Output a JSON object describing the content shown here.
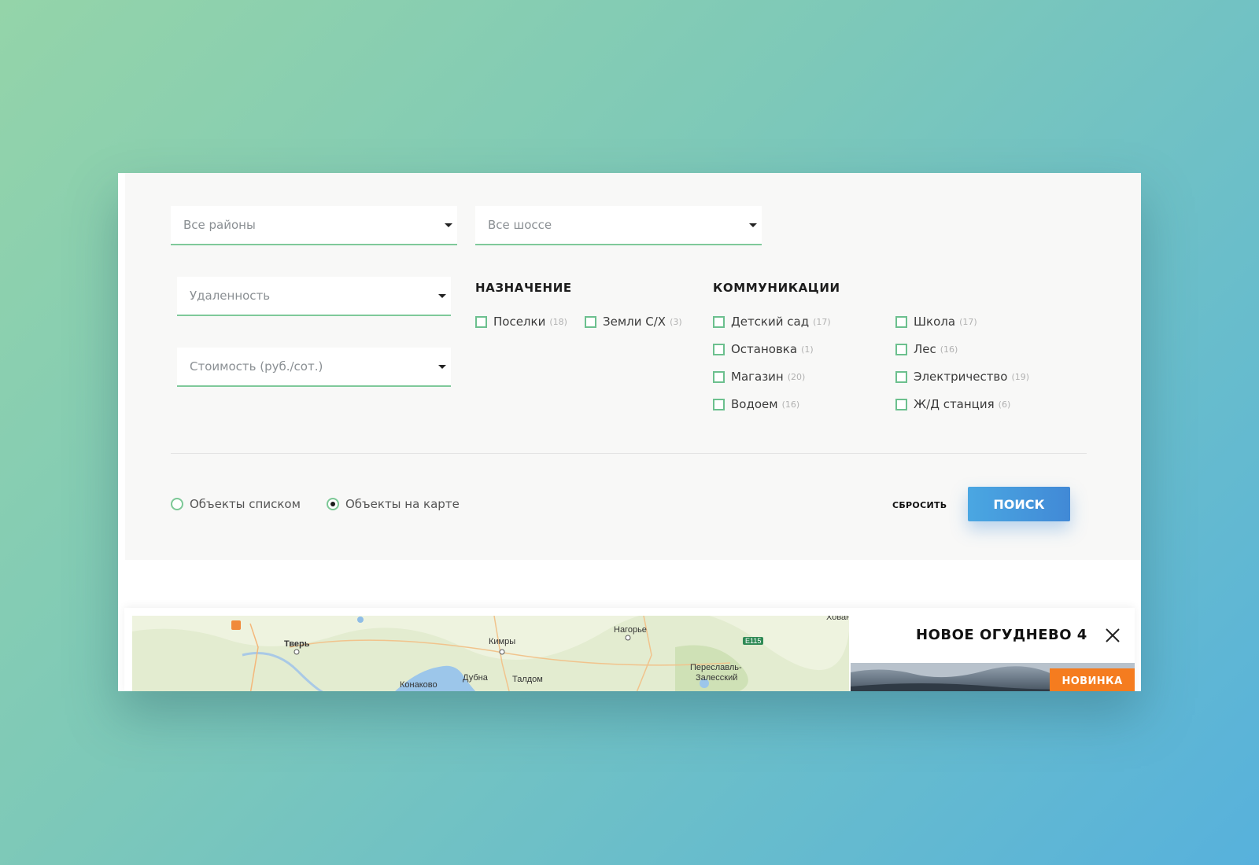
{
  "filters": {
    "district": {
      "placeholder": "Все районы"
    },
    "highway": {
      "placeholder": "Все шоссе"
    },
    "distance": {
      "placeholder": "Удаленность"
    },
    "price": {
      "placeholder": "Стоимость (руб./сот.)"
    }
  },
  "purpose": {
    "title": "НАЗНАЧЕНИЕ",
    "items": [
      {
        "label": "Поселки",
        "count": "(18)",
        "checked": false
      },
      {
        "label": "Земли С/Х",
        "count": "(3)",
        "checked": false
      }
    ]
  },
  "communications": {
    "title": "КОММУНИКАЦИИ",
    "items": [
      {
        "label": "Детский сад",
        "count": "(17)",
        "checked": false
      },
      {
        "label": "Остановка",
        "count": "(1)",
        "checked": false
      },
      {
        "label": "Магазин",
        "count": "(20)",
        "checked": false
      },
      {
        "label": "Водоем",
        "count": "(16)",
        "checked": false
      },
      {
        "label": "Школа",
        "count": "(17)",
        "checked": false
      },
      {
        "label": "Лес",
        "count": "(16)",
        "checked": false
      },
      {
        "label": "Электричество",
        "count": "(19)",
        "checked": false
      },
      {
        "label": "Ж/Д станция",
        "count": "(6)",
        "checked": false
      }
    ]
  },
  "view_mode": {
    "options": [
      {
        "label": "Объекты списком",
        "selected": false
      },
      {
        "label": "Объекты на карте",
        "selected": true
      }
    ]
  },
  "actions": {
    "reset": "сбросить",
    "search": "ПОИСК"
  },
  "map": {
    "labels": [
      "Тверь",
      "Кимры",
      "Нагорье",
      "Конаково",
      "Дубна",
      "Талдом",
      "Переславль-",
      "Залесский",
      "Хован"
    ],
    "road_badge": "E115"
  },
  "object_card": {
    "title": "НОВОЕ ОГУДНЕВО 4",
    "badge": "НОВИНКА"
  },
  "colors": {
    "accent_green": "#7fc99a",
    "search_blue": "#4a9ee0",
    "badge_orange": "#f57c1f"
  }
}
